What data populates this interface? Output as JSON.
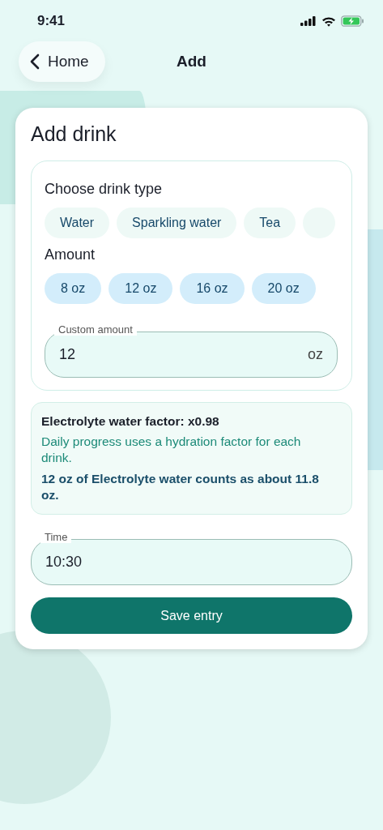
{
  "status_bar": {
    "time": "9:41"
  },
  "nav": {
    "back_label": "Home",
    "title": "Add"
  },
  "card": {
    "title": "Add drink",
    "drink_type": {
      "label": "Choose drink type",
      "options": [
        "Water",
        "Sparkling water",
        "Tea"
      ]
    },
    "amount": {
      "label": "Amount",
      "presets": [
        "8 oz",
        "12 oz",
        "16 oz",
        "20 oz"
      ],
      "custom": {
        "label": "Custom amount",
        "value": "12",
        "unit": "oz"
      }
    },
    "info": {
      "heading": "Electrolyte water factor: x0.98",
      "note": "Daily progress uses a hydration factor for each drink.",
      "result": "12 oz of Electrolyte water counts as about 11.8 oz."
    },
    "time": {
      "label": "Time",
      "value": "10:30"
    },
    "save_button": "Save entry"
  }
}
